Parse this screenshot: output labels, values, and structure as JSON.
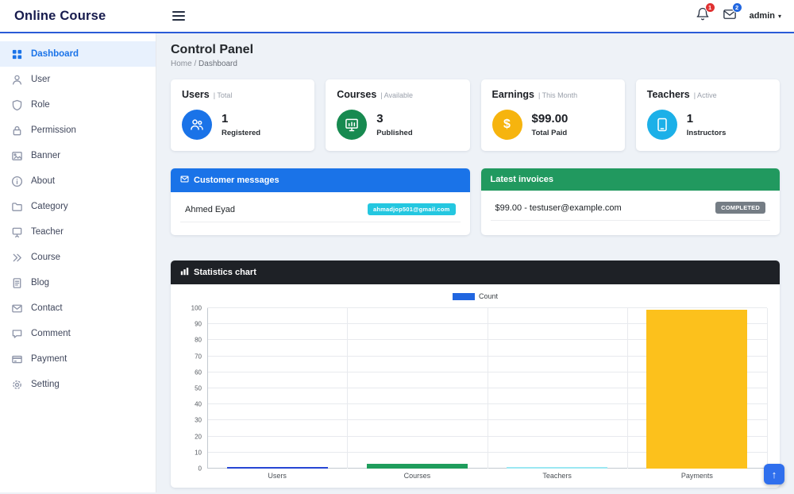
{
  "topbar": {
    "brand": "Online Course",
    "admin_label": "admin",
    "bell_badge": "1",
    "mail_badge": "2"
  },
  "sidebar": {
    "items": [
      {
        "label": "Dashboard"
      },
      {
        "label": "User"
      },
      {
        "label": "Role"
      },
      {
        "label": "Permission"
      },
      {
        "label": "Banner"
      },
      {
        "label": "About"
      },
      {
        "label": "Category"
      },
      {
        "label": "Teacher"
      },
      {
        "label": "Course"
      },
      {
        "label": "Blog"
      },
      {
        "label": "Contact"
      },
      {
        "label": "Comment"
      },
      {
        "label": "Payment"
      },
      {
        "label": "Setting"
      }
    ]
  },
  "main": {
    "title": "Control Panel",
    "breadcrumb_home": "Home",
    "breadcrumb_sep": "/",
    "breadcrumb_current": "Dashboard",
    "stats": [
      {
        "title": "Users",
        "qualifier": "| Total",
        "value": "1",
        "caption": "Registered",
        "color": "#1a73e8"
      },
      {
        "title": "Courses",
        "qualifier": "| Available",
        "value": "3",
        "caption": "Published",
        "color": "#178a50"
      },
      {
        "title": "Earnings",
        "qualifier": "| This Month",
        "value": "$99.00",
        "caption": "Total Paid",
        "color": "#f6b40e"
      },
      {
        "title": "Teachers",
        "qualifier": "| Active",
        "value": "1",
        "caption": "Instructors",
        "color": "#1cb0e8"
      }
    ],
    "messages": {
      "title": "Customer messages",
      "header_color": "#1a73e8",
      "rows": [
        {
          "name": "Ahmed Eyad",
          "badge": "ahmadjop501@gmail.com",
          "badge_color": "#24c7e0"
        }
      ]
    },
    "invoices": {
      "title": "Latest invoices",
      "header_color": "#21995f",
      "rows": [
        {
          "text": "$99.00 - testuser@example.com",
          "badge": "COMPLETED",
          "badge_color": "#757d85"
        }
      ]
    }
  },
  "chart_data": {
    "type": "bar",
    "title": "Statistics chart",
    "legend": [
      {
        "name": "Count",
        "color": "#2166e0"
      }
    ],
    "legend_position": "top-center",
    "categories": [
      "Users",
      "Courses",
      "Teachers",
      "Payments"
    ],
    "series": [
      {
        "name": "Count",
        "values": [
          1,
          3,
          1,
          99
        ]
      }
    ],
    "bar_colors": [
      "#2646d4",
      "#1f9d5c",
      "#9be8f2",
      "#fcc11c"
    ],
    "ylim": [
      0,
      100
    ],
    "ytick_step": 10,
    "grid": true,
    "xlabel": "",
    "ylabel": ""
  },
  "scroll_top": {
    "arrow": "↑"
  }
}
